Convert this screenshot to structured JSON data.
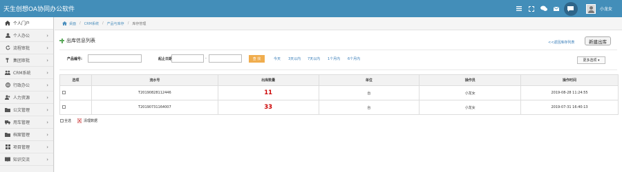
{
  "app": {
    "title": "天生创想OA协同办公软件"
  },
  "header": {
    "icons": [
      "menu-lines-icon",
      "fullscreen-icon",
      "chat-bubbles-icon",
      "mail-icon",
      "message-icon"
    ],
    "user": {
      "name": "小龙女"
    }
  },
  "sidebar": {
    "items": [
      {
        "label": "个人门户",
        "icon": "home-icon",
        "active": true
      },
      {
        "label": "个人办公",
        "icon": "person-icon"
      },
      {
        "label": "流程审批",
        "icon": "refresh-icon"
      },
      {
        "label": "集团审批",
        "icon": "hammer-icon"
      },
      {
        "label": "CRM系统",
        "icon": "group-icon"
      },
      {
        "label": "行政办公",
        "icon": "globe-icon"
      },
      {
        "label": "人力资源",
        "icon": "people-icon"
      },
      {
        "label": "公文管理",
        "icon": "folder-icon"
      },
      {
        "label": "用车管理",
        "icon": "truck-icon"
      },
      {
        "label": "档案管理",
        "icon": "archive-icon"
      },
      {
        "label": "项目管理",
        "icon": "grid-icon"
      },
      {
        "label": "知识交流",
        "icon": "book-icon"
      }
    ]
  },
  "breadcrumb": {
    "home": "桌面",
    "items": [
      "CRM系统",
      "产品与库存",
      "库存管理"
    ]
  },
  "page": {
    "title": "出库信息列表",
    "back_link": "<<返回库存列表",
    "new_button": "新建出库"
  },
  "filter": {
    "product_label": "产品编号:",
    "product_value": "",
    "date_label": "起止日期:",
    "date_start": "",
    "date_end": "",
    "dash": "-",
    "search_button": "查 找",
    "quick_links": [
      "今天",
      "3天以内",
      "7天以内",
      "1个月内",
      "6个月内"
    ],
    "more_button": "更多选项 ▾"
  },
  "table": {
    "columns": [
      "选项",
      "流水号",
      "出库数量",
      "单位",
      "操作员",
      "操作时间"
    ],
    "rows": [
      {
        "serial": "T20190828112446",
        "quantity": "11",
        "unit": "台",
        "operator": "小龙女",
        "time": "2019-08-28 11:24:55"
      },
      {
        "serial": "T20190731164007",
        "quantity": "33",
        "unit": "台",
        "operator": "小龙女",
        "time": "2019-07-31 16:40:13"
      }
    ]
  },
  "footer": {
    "select_all": "全选",
    "clear": "清理数据"
  }
}
